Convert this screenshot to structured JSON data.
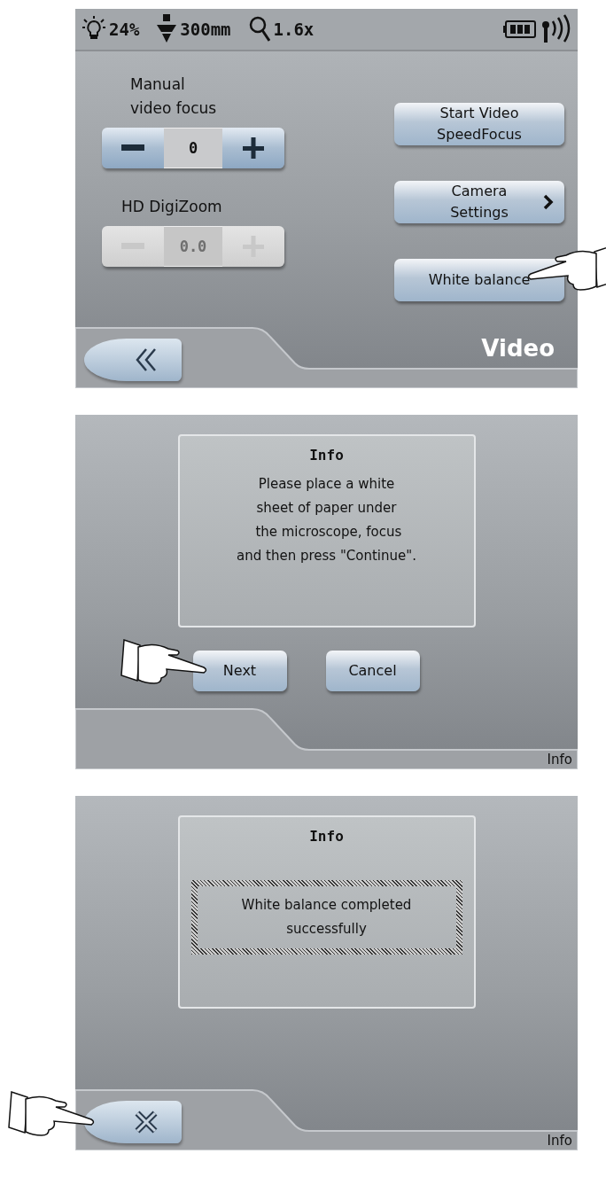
{
  "screens": [
    {
      "kind": "menu",
      "status_bar": {
        "illumination": "24%",
        "working_distance": "300mm",
        "magnification": "1.6x"
      },
      "steppers": [
        {
          "label": "Manual\nvideo focus",
          "value": "0",
          "disabled": false
        },
        {
          "label": "HD DigiZoom",
          "value": "0.0",
          "disabled": true
        }
      ],
      "buttons": [
        {
          "label": "Start Video\nSpeedFocus",
          "submenu": false,
          "pointed": false
        },
        {
          "label": "Camera\nSettings",
          "submenu": true,
          "pointed": false
        },
        {
          "label": "White balance",
          "submenu": false,
          "pointed": true
        }
      ],
      "nav_button": {
        "kind": "back",
        "pointed": false
      },
      "footer": {
        "text": "Video",
        "emphasis": true
      }
    },
    {
      "kind": "dialog",
      "dialog": {
        "title": "Info",
        "message": "Please place a white\nsheet of paper under\n the microscope, focus\nand then press \"Continue\".",
        "framed": false
      },
      "buttons": [
        {
          "label": "Next",
          "submenu": false,
          "pointed": true
        },
        {
          "label": "Cancel",
          "submenu": false,
          "pointed": false
        }
      ],
      "footer": {
        "text": "Info",
        "emphasis": false
      }
    },
    {
      "kind": "dialog",
      "dialog": {
        "title": "Info",
        "message": "White balance completed\nsuccessfully",
        "framed": true
      },
      "nav_button": {
        "kind": "close",
        "pointed": true
      },
      "footer": {
        "text": "Info",
        "emphasis": false
      }
    }
  ]
}
